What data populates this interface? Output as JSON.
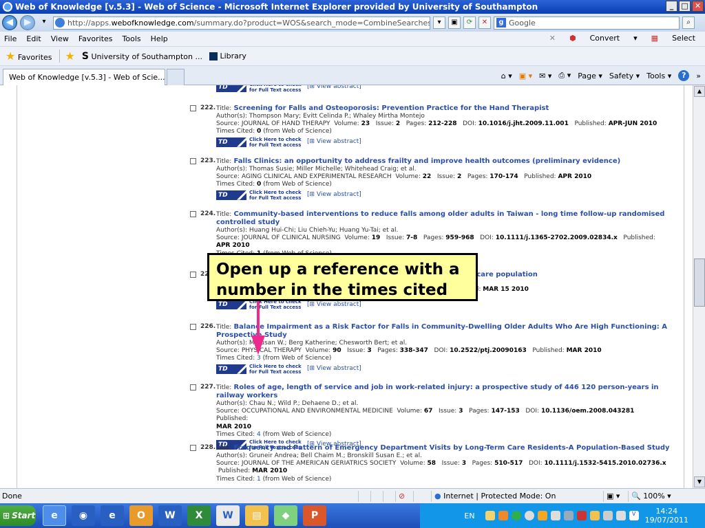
{
  "window": {
    "title": "Web of Knowledge [v.5.3] - Web of Science - Microsoft Internet Explorer provided by University of Southampton"
  },
  "address": {
    "url_prefix": "http://apps.",
    "url_domain": "webofknowledge.com",
    "url_rest": "/summary.do?product=WOS&search_mode=CombineSearches&qid=!",
    "search_placeholder": "Google"
  },
  "menu": [
    "File",
    "Edit",
    "View",
    "Favorites",
    "Tools",
    "Help"
  ],
  "menu_right": {
    "convert": "Convert",
    "select": "Select"
  },
  "favorites": {
    "label": "Favorites",
    "items": [
      "University of Southampton ...",
      "Library"
    ]
  },
  "tab": {
    "label": "Web of Knowledge [v.5.3] - Web of Scie..."
  },
  "commands": {
    "page": "Page",
    "safety": "Safety",
    "tools": "Tools"
  },
  "fulltext": {
    "line1": "Click Here to check",
    "line2": "for Full Text access",
    "abstract": "[⊞ View abstract]"
  },
  "labels": {
    "title": "Title:",
    "authors": "Author(s):",
    "source": "Source:",
    "volume": "Volume:",
    "issue": "Issue:",
    "pages": "Pages:",
    "doi": "DOI:",
    "published": "Published:",
    "times_cited": "Times Cited:",
    "from_wos": "(from Web of Science)"
  },
  "records": [
    {
      "num": "222.",
      "title": "Screening for Falls and Osteoporosis: Prevention Practice for the Hand Therapist",
      "authors": "Thompson Mary; Evitt Celinda P.; Whaley Mirtha Montejo",
      "source": "JOURNAL OF HAND THERAPY",
      "volume": "23",
      "issue": "2",
      "pages": "212-228",
      "doi": "10.1016/j.jht.2009.11.001",
      "published": "APR-JUN 2010",
      "cited": "0"
    },
    {
      "num": "223.",
      "title": "Falls Clinics: an opportunity to address frailty and improve health outcomes (preliminary evidence)",
      "authors": "Thomas Susie; Miller Michelle; Whitehead Craig; et al.",
      "source": "AGING CLINICAL AND EXPERIMENTAL RESEARCH",
      "volume": "22",
      "issue": "2",
      "pages": "170-174",
      "doi": "",
      "published": "APR 2010",
      "cited": "0"
    },
    {
      "num": "224.",
      "title": "Community-based interventions to reduce falls among older adults in Taiwan - long time follow-up randomised controlled study",
      "authors": "Huang Hui-Chi; Liu Chieh-Yu; Huang Yu-Tai; et al.",
      "source": "JOURNAL OF CLINICAL NURSING",
      "volume": "19",
      "issue": "7-8",
      "pages": "959-968",
      "doi": "10.1111/j.1365-2702.2009.02834.x",
      "published": "APR 2010",
      "cited": "1"
    },
    {
      "num": "22",
      "title": "residential aged care population",
      "published": "MAR 15 2010"
    },
    {
      "num": "226.",
      "title": "Balance Impairment as a Risk Factor for Falls in Community-Dwelling Older Adults Who Are High Functioning: A Prospective Study",
      "authors": "M   Susan W.; Berg Katherine; Chesworth Bert; et al.",
      "source": "PHYSICAL THERAPY",
      "volume": "90",
      "issue": "3",
      "pages": "338-347",
      "doi": "10.2522/ptj.20090163",
      "published": "MAR 2010",
      "cited": "3"
    },
    {
      "num": "227.",
      "title": "Roles of age, length of service and job in work-related injury: a prospective study of 446 120 person-years in railway workers",
      "authors": "Chau N.; Wild P.; Dehaene D.; et al.",
      "source": "OCCUPATIONAL AND ENVIRONMENTAL MEDICINE",
      "volume": "67",
      "issue": "3",
      "pages": "147-153",
      "doi": "10.1136/oem.2008.043281",
      "published": "MAR 2010",
      "cited": "4"
    },
    {
      "num": "228.",
      "title": "Frequency and Pattern of Emergency Department Visits by Long-Term Care Residents-A Population-Based Study",
      "authors": "Gruneir Andrea; Bell Chaim M.; Bronskill Susan E.; et al.",
      "source": "JOURNAL OF THE AMERICAN GERIATRICS SOCIETY",
      "volume": "58",
      "issue": "3",
      "pages": "510-517",
      "doi": "10.1111/j.1532-5415.2010.02736.x",
      "published": "MAR 2010",
      "cited": "1"
    }
  ],
  "callout": {
    "text": "Open up a reference with a number in the times cited",
    "bg_color": "#ffff9e",
    "arrow_color": "#ee2a8f"
  },
  "status": {
    "left": "Done",
    "zone": "Internet | Protected Mode: On",
    "zoom": "100%"
  },
  "taskbar": {
    "start": "Start",
    "lang": "EN",
    "time": "14:24",
    "date": "19/07/2011"
  }
}
